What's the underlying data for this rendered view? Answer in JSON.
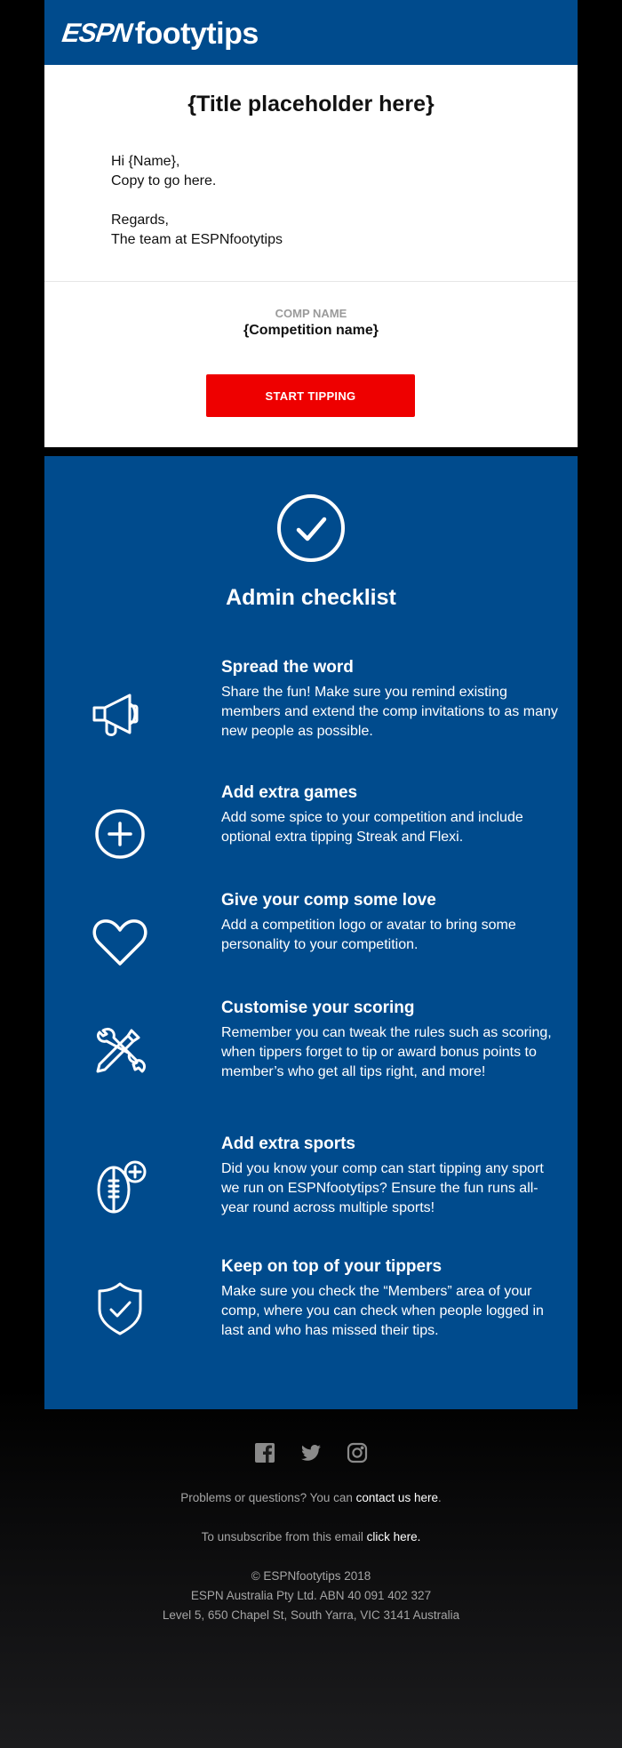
{
  "header": {
    "logo_espn": "ESPN",
    "logo_footy": "footytips",
    "bg_color": "#004b8d"
  },
  "card": {
    "title": "{Title placeholder here}",
    "greeting": "Hi {Name},",
    "copy": "Copy to go here.",
    "regards": "Regards,",
    "signature": "The team at ESPNfootytips",
    "comp_label": "COMP NAME",
    "comp_name": "{Competition name}",
    "cta_label": "START TIPPING",
    "cta_color": "#ee0000"
  },
  "checklist": {
    "title": "Admin checklist",
    "badge_icon": "check-circle-icon",
    "items": [
      {
        "icon": "megaphone-icon",
        "title": "Spread the word",
        "desc": "Share the fun! Make sure you remind existing members and extend the comp invitations to as many new people as possible."
      },
      {
        "icon": "plus-circle-icon",
        "title": "Add extra games",
        "desc": "Add some spice to your competition and include optional extra tipping Streak and Flexi."
      },
      {
        "icon": "heart-icon",
        "title": "Give your comp some love",
        "desc": "Add a competition logo or avatar to bring some personality to your competition."
      },
      {
        "icon": "tools-icon",
        "title": "Customise your scoring",
        "desc": "Remember you can tweak the rules such as scoring, when tippers forget to tip or award bonus points to member’s who get all tips right, and more!"
      },
      {
        "icon": "football-plus-icon",
        "title": "Add extra sports",
        "desc": "Did you know your comp can start tipping any sport we run on ESPNfootytips? Ensure the fun runs all-year round across multiple sports!"
      },
      {
        "icon": "shield-check-icon",
        "title": "Keep on top of your tippers",
        "desc": "Make sure you check the “Members” area of your comp, where you can check when people logged in last and who has missed their tips."
      }
    ]
  },
  "footer": {
    "social": [
      "facebook-icon",
      "twitter-icon",
      "instagram-icon"
    ],
    "problems_text": "Problems or questions? You can ",
    "contact_link": "contact us here",
    "problems_end": ".",
    "unsubscribe_text": "To unsubscribe from this email ",
    "unsubscribe_link": "click here.",
    "copyright": "© ESPNfootytips 2018",
    "company": "ESPN Australia Pty Ltd. ABN 40 091 402 327",
    "address": "Level 5, 650 Chapel St, South Yarra, VIC 3141 Australia"
  }
}
